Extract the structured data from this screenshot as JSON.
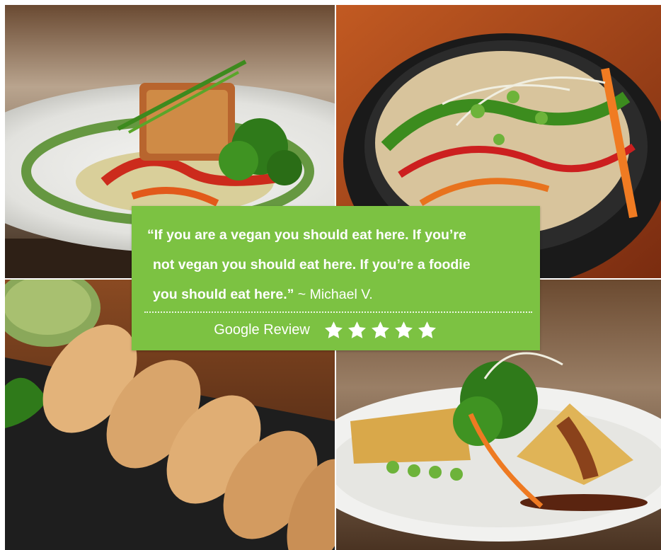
{
  "photos": [
    {
      "subject": "plated tofu with greens and herb sauce"
    },
    {
      "subject": "noodle salad bowl with vegetables and sprouts"
    },
    {
      "subject": "pan-fried dumplings with dipping sauce"
    },
    {
      "subject": "crispy tofu triangles with greens and sauce"
    }
  ],
  "review": {
    "quote_line1": "“If you are a vegan you should eat here. If you’re",
    "quote_line2": "not vegan you should eat here. If you’re a foodie",
    "quote_line3": "you should eat here.”",
    "author": " ~ Michael V.",
    "source": "Google Review",
    "rating": 5,
    "max_rating": 5
  },
  "colors": {
    "accent": "#7cc242",
    "text": "#ffffff",
    "star": "#ffffff"
  },
  "icons": [
    "star-icon"
  ]
}
